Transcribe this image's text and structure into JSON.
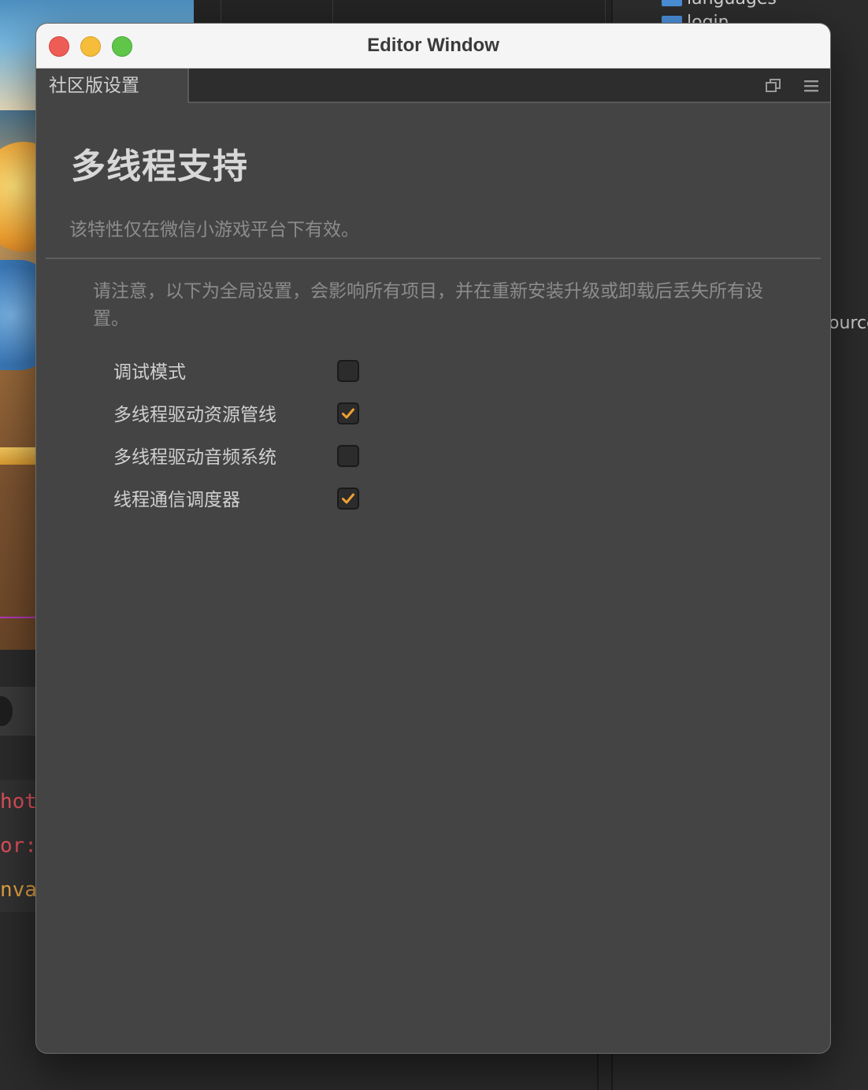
{
  "window": {
    "title": "Editor Window",
    "tab_label": "社区版设置"
  },
  "panel": {
    "heading": "多线程支持",
    "subtitle": "该特性仅在微信小游戏平台下有效。",
    "notice": "请注意，以下为全局设置，会影响所有项目，并在重新安装升级或卸载后丢失所有设置。",
    "options": [
      {
        "label": "调试模式",
        "checked": false
      },
      {
        "label": "多线程驱动资源管线",
        "checked": true
      },
      {
        "label": "多线程驱动音频系统",
        "checked": false
      },
      {
        "label": "线程通信调度器",
        "checked": true
      }
    ]
  },
  "background": {
    "tree_items": [
      "languages",
      "login"
    ],
    "right_text": "ource",
    "code_lines": [
      "hot",
      "or:",
      "nva"
    ]
  },
  "colors": {
    "check_accent": "#f0a030",
    "checkbox_bg": "#2c2c2c",
    "panel_bg": "#444444"
  }
}
